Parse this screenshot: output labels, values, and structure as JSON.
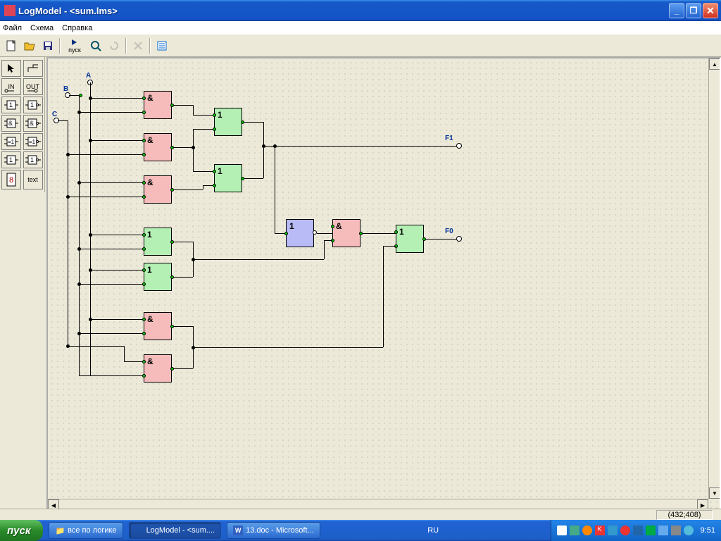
{
  "title": "LogModel - <sum.lms>",
  "menu": {
    "file": "Файл",
    "schema": "Схема",
    "help": "Справка"
  },
  "toolbar": {
    "pusk": "пуск"
  },
  "palette": {
    "in": "IN",
    "out": "OUT",
    "text": "text"
  },
  "canvas": {
    "inputs": {
      "A": "A",
      "B": "B",
      "C": "C"
    },
    "outputs": {
      "F1": "F1",
      "F0": "F0"
    },
    "gate_and": "&",
    "gate_or": "1",
    "gate_not": "1"
  },
  "status": {
    "coords": "(432;408)"
  },
  "taskbar": {
    "start": "пуск",
    "tasks": [
      {
        "label": "все по логике"
      },
      {
        "label": "LogModel - <sum...."
      },
      {
        "label": "13.doc - Microsoft..."
      }
    ],
    "lang": "RU",
    "clock": "9:51"
  }
}
